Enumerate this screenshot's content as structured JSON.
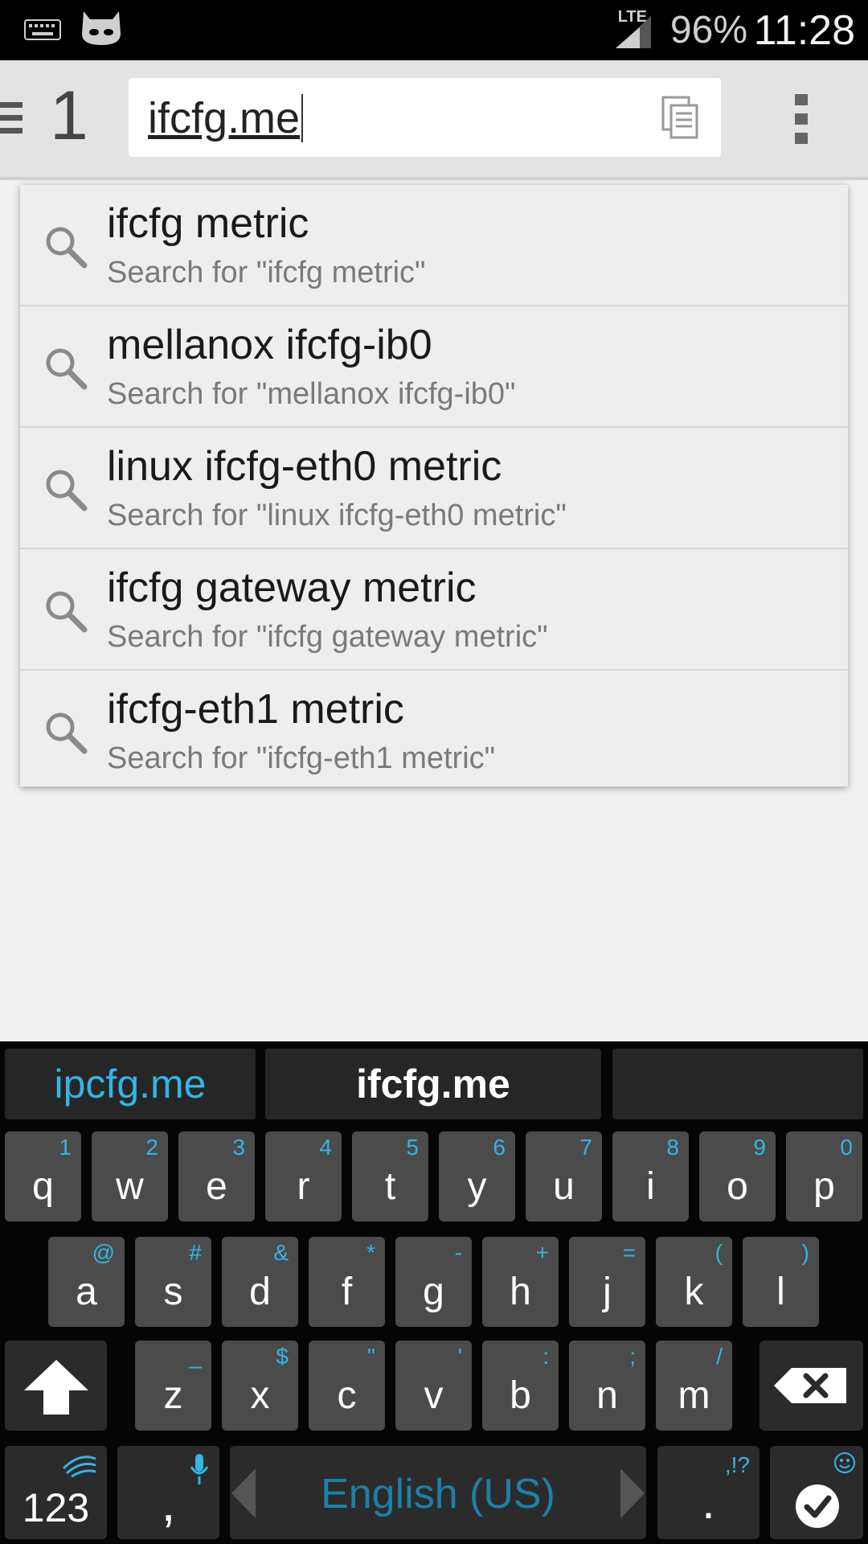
{
  "status_bar": {
    "time": "11:28",
    "battery": "96%",
    "network": "LTE"
  },
  "toolbar": {
    "tab_count": "1",
    "url_text": "ifcfg.me"
  },
  "suggestions": [
    {
      "title": "ifcfg metric",
      "subtitle": "Search for \"ifcfg metric\""
    },
    {
      "title": "mellanox ifcfg-ib0",
      "subtitle": "Search for \"mellanox ifcfg-ib0\""
    },
    {
      "title": "linux ifcfg-eth0 metric",
      "subtitle": "Search for \"linux ifcfg-eth0 metric\""
    },
    {
      "title": "ifcfg gateway metric",
      "subtitle": "Search for \"ifcfg gateway metric\""
    },
    {
      "title": "ifcfg-eth1 metric",
      "subtitle": "Search for \"ifcfg-eth1 metric\""
    }
  ],
  "keyboard": {
    "candidates": [
      "ipcfg.me",
      "ifcfg.me",
      ""
    ],
    "row1": [
      {
        "k": "q",
        "a": "1"
      },
      {
        "k": "w",
        "a": "2"
      },
      {
        "k": "e",
        "a": "3"
      },
      {
        "k": "r",
        "a": "4"
      },
      {
        "k": "t",
        "a": "5"
      },
      {
        "k": "y",
        "a": "6"
      },
      {
        "k": "u",
        "a": "7"
      },
      {
        "k": "i",
        "a": "8"
      },
      {
        "k": "o",
        "a": "9"
      },
      {
        "k": "p",
        "a": "0"
      }
    ],
    "row2": [
      {
        "k": "a",
        "a": "@"
      },
      {
        "k": "s",
        "a": "#"
      },
      {
        "k": "d",
        "a": "&"
      },
      {
        "k": "f",
        "a": "*"
      },
      {
        "k": "g",
        "a": "-"
      },
      {
        "k": "h",
        "a": "+"
      },
      {
        "k": "j",
        "a": "="
      },
      {
        "k": "k",
        "a": "("
      },
      {
        "k": "l",
        "a": ")"
      }
    ],
    "row3": [
      {
        "k": "z",
        "a": "_"
      },
      {
        "k": "x",
        "a": "$"
      },
      {
        "k": "c",
        "a": "\""
      },
      {
        "k": "v",
        "a": "'"
      },
      {
        "k": "b",
        "a": ":"
      },
      {
        "k": "n",
        "a": ";"
      },
      {
        "k": "m",
        "a": "/"
      }
    ],
    "numbers_label": "123",
    "comma_label": ",",
    "space_label": "English (US)",
    "period_label": ".",
    "period_alt": ",!?"
  },
  "colors": {
    "accent": "#33b5e5",
    "key": "#4b4b4b",
    "keyboard_bg": "#050505"
  }
}
